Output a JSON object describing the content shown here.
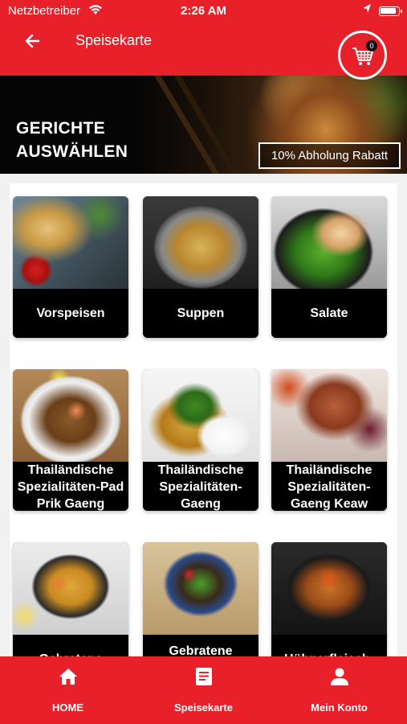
{
  "status_bar": {
    "carrier": "Netzbetreiber",
    "time": "2:26 AM"
  },
  "header": {
    "title": "Speisekarte",
    "cart_count": "0"
  },
  "banner": {
    "title_line1": "GERICHTE",
    "title_line2": "AUSWÄHLEN",
    "promo": "10% Abholung Rabatt"
  },
  "categories": [
    {
      "label": "Vorspeisen"
    },
    {
      "label": "Suppen"
    },
    {
      "label": "Salate"
    },
    {
      "label": "Thailändische Spezialitäten-Pad Prik Gaeng"
    },
    {
      "label": "Thailändische Spezialitäten-Gaeng Massaman"
    },
    {
      "label": "Thailändische Spezialitäten-Gaeng Keaw Wahn"
    },
    {
      "label": "Gebratene"
    },
    {
      "label": "Gebratene Nudeln"
    },
    {
      "label": "Hühnerfleisch-"
    }
  ],
  "bottom_nav": [
    {
      "label": "HOME",
      "icon": "home-icon"
    },
    {
      "label": "Speisekarte",
      "icon": "menu-icon"
    },
    {
      "label": "Mein Konto",
      "icon": "account-icon"
    }
  ],
  "colors": {
    "brand_red": "#e8202a",
    "label_bg": "#000000"
  }
}
